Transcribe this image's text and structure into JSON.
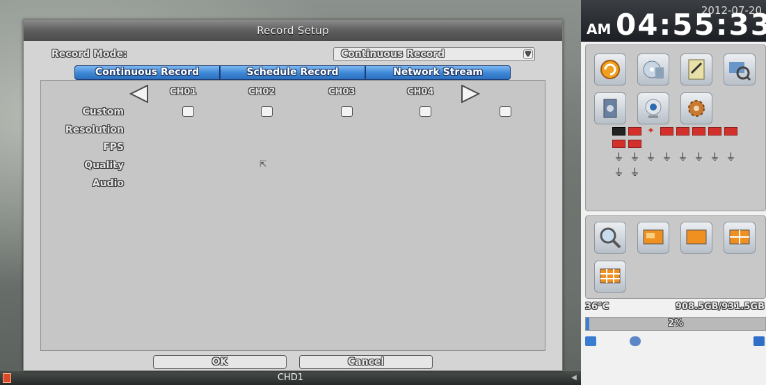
{
  "dialog": {
    "title": "Record Setup",
    "record_mode_label": "Record Mode:",
    "record_mode_value": "Continuous Record",
    "tabs": [
      "Continuous Record",
      "Schedule Record",
      "Network Stream"
    ],
    "channels": [
      "CH01",
      "CH02",
      "CH03",
      "CH04"
    ],
    "row_labels": [
      "Custom",
      "Resolution",
      "FPS",
      "Quality",
      "Audio"
    ],
    "ok_label": "OK",
    "cancel_label": "Cancel"
  },
  "bottom_bar": {
    "camera_label": "CHD1"
  },
  "side": {
    "date": "2012-07-20",
    "ampm": "AM",
    "time": "04:55:33",
    "temperature": "36°C",
    "hdd_usage": "908.5GB/931.5GB",
    "hdd_percent": "2%",
    "hdd_fill_fraction": 0.02
  }
}
